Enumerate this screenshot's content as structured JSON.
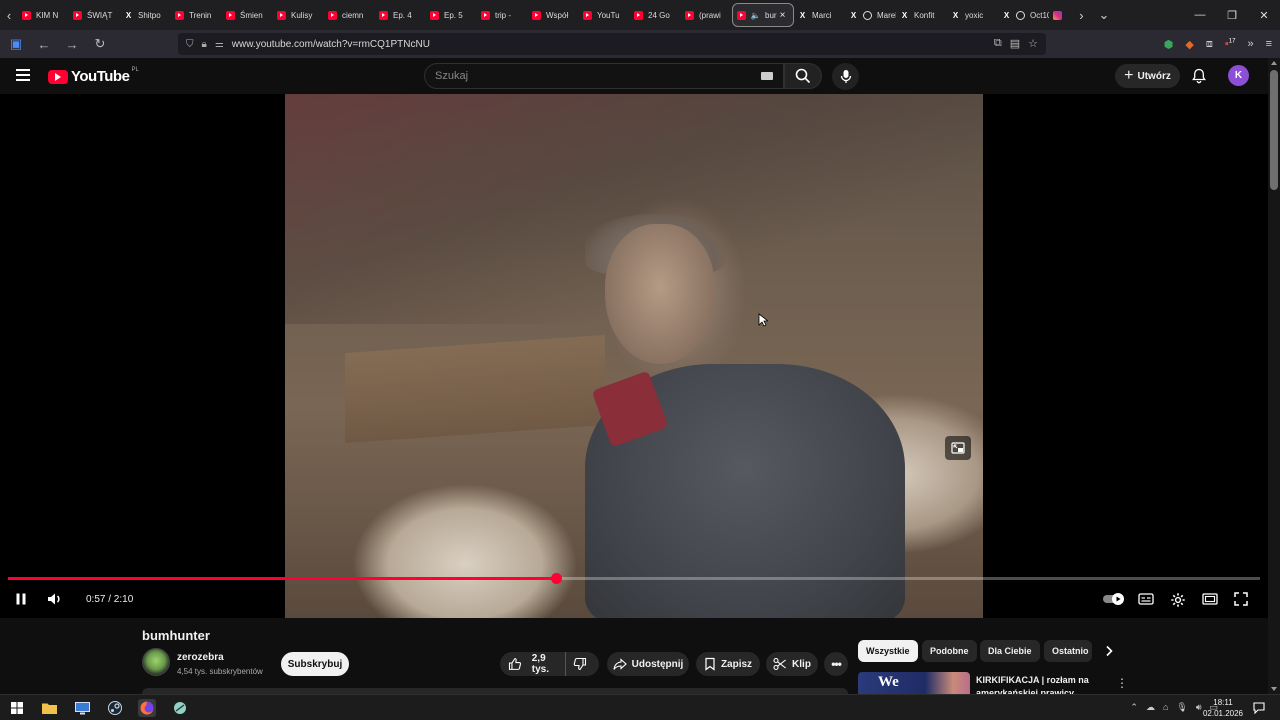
{
  "browser": {
    "tabs": [
      {
        "label": "KIM N",
        "icon": "youtube-icon"
      },
      {
        "label": "ŚWIĄT",
        "icon": "youtube-icon"
      },
      {
        "label": "Shitpo",
        "icon": "x-icon"
      },
      {
        "label": "Trenin",
        "icon": "youtube-icon"
      },
      {
        "label": "Śmien",
        "icon": "youtube-icon"
      },
      {
        "label": "Kulisy",
        "icon": "youtube-icon"
      },
      {
        "label": "ciemn",
        "icon": "youtube-icon"
      },
      {
        "label": "Ep. 4",
        "icon": "youtube-icon"
      },
      {
        "label": "Ep. 5",
        "icon": "youtube-icon"
      },
      {
        "label": "trip -",
        "icon": "youtube-icon"
      },
      {
        "label": "Współ",
        "icon": "youtube-icon"
      },
      {
        "label": "YouTu",
        "icon": "youtube-icon"
      },
      {
        "label": "24 Go",
        "icon": "youtube-icon"
      },
      {
        "label": "(prawi",
        "icon": "youtube-icon"
      },
      {
        "label": "bur",
        "icon": "youtube-icon",
        "active": true
      },
      {
        "label": "Marci",
        "icon": "x-icon"
      },
      {
        "label": "Marek",
        "icon": "x-icon"
      },
      {
        "label": "Konfit",
        "icon": "x-icon"
      },
      {
        "label": "yoxic",
        "icon": "x-icon"
      },
      {
        "label": "Oct10",
        "icon": "x-icon"
      }
    ],
    "url": "www.youtube.com/watch?v=rmCQ1PTNcNU",
    "extension_badge": "17"
  },
  "youtube": {
    "logo_text": "YouTube",
    "country_code": "PL",
    "search_placeholder": "Szukaj",
    "create_label": "Utwórz",
    "avatar_letter": "K"
  },
  "player": {
    "current_time": "0:57",
    "duration": "2:10",
    "time_display": "0:57 / 2:10",
    "progress_fraction": 0.438,
    "accent_color": "#ff0033"
  },
  "video": {
    "title": "bumhunter",
    "channel_name": "zerozebra",
    "subscribers": "4,54 tys. subskrybentów",
    "subscribe_label": "Subskrybuj",
    "likes": "2,9 tys.",
    "share_label": "Udostępnij",
    "save_label": "Zapisz",
    "clip_label": "Klip"
  },
  "sidebar": {
    "chips": [
      {
        "label": "Wszystkie",
        "active": true
      },
      {
        "label": "Podobne"
      },
      {
        "label": "Dla Ciebie"
      },
      {
        "label": "Ostatnio"
      }
    ],
    "recommendation": {
      "thumb_text": "We",
      "title": "KIRKIFIKACJA | rozłam na amerykańskiej prawicy"
    }
  },
  "taskbar": {
    "time": "18:11",
    "date": "02.01.2026"
  }
}
